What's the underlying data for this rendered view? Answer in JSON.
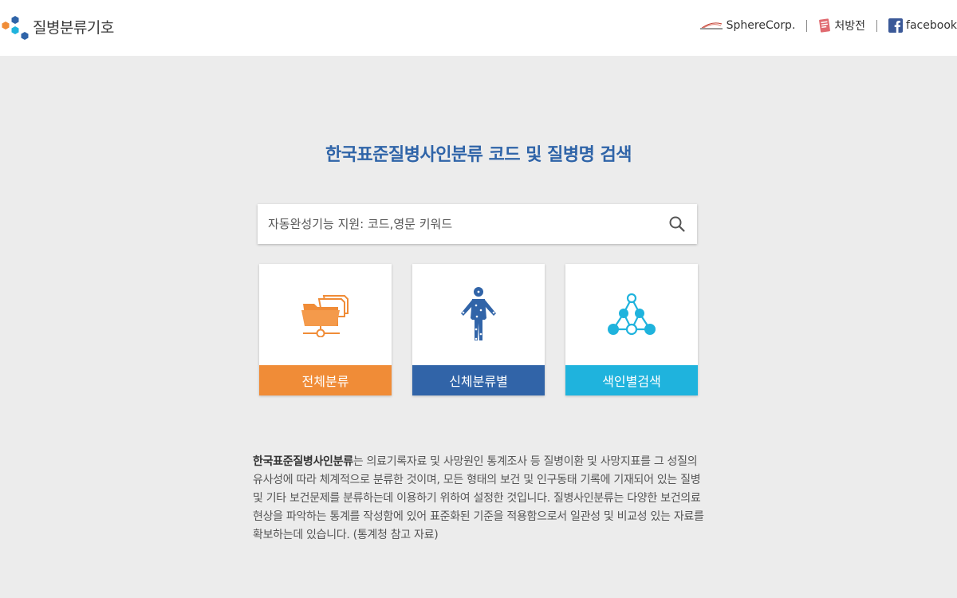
{
  "header": {
    "logo_text": "질병분류기호",
    "nav": [
      {
        "label": "SphereCorp.",
        "icon": "spherecorp-logo-icon"
      },
      {
        "label": "처방전",
        "icon": "prescription-icon"
      },
      {
        "label": "facebook",
        "icon": "facebook-icon"
      }
    ]
  },
  "main": {
    "title": "한국표준질병사인분류 코드 및 질병명 검색",
    "search": {
      "placeholder": "자동완성기능 지원: 코드,영문 키워드",
      "value": "",
      "icon": "search-icon"
    },
    "cards": [
      {
        "label": "전체분류",
        "icon": "folder-network-icon",
        "color": "#f08c37"
      },
      {
        "label": "신체분류별",
        "icon": "human-body-icon",
        "color": "#3164a8"
      },
      {
        "label": "색인별검색",
        "icon": "tree-nodes-icon",
        "color": "#1fb3dd"
      }
    ],
    "description": {
      "bold": "한국표준질병사인분류",
      "text": "는 의료기록자료 및 사망원인 통계조사 등 질병이환 및 사망지표를 그 성질의 유사성에 따라 체계적으로 분류한 것이며, 모든 형태의 보건 및 인구동태 기록에 기재되어 있는 질병 및 기타 보건문제를 분류하는데 이용하기 위하여 설정한 것입니다. 질병사인분류는 다양한 보건의료 현상을 파악하는 통계를 작성함에 있어 표준화된 기준을 적용함으로서 일관성 및 비교성 있는 자료를 확보하는데 있습니다. (통계청 참고 자료)"
    }
  },
  "colors": {
    "title": "#2f64a8",
    "orange": "#f08c37",
    "blue": "#3164a8",
    "cyan": "#1fb3dd"
  }
}
